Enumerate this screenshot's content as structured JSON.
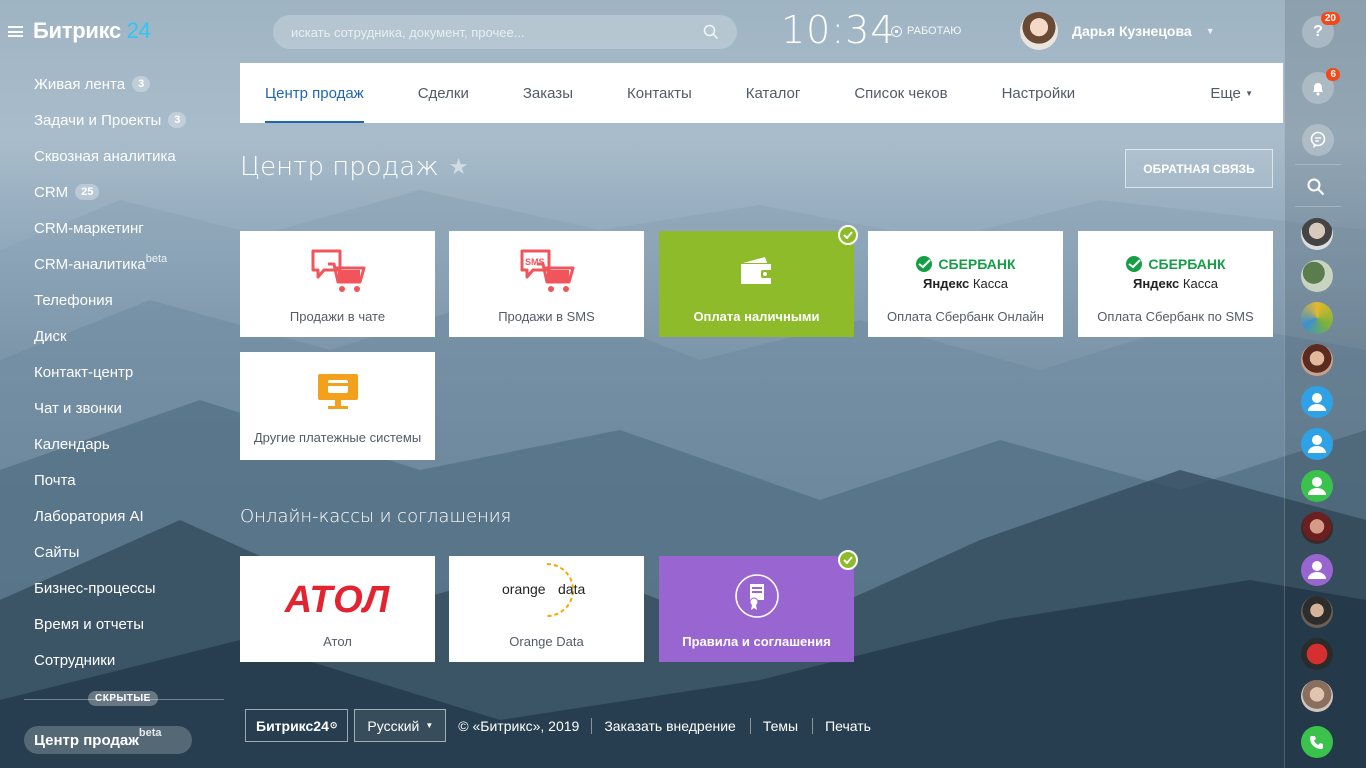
{
  "app": {
    "logo_main": "Битрикс",
    "logo_num": "24"
  },
  "search": {
    "placeholder": "искать сотрудника, документ, прочее..."
  },
  "clock": {
    "time": "10:34",
    "status": "РАБОТАЮ"
  },
  "user": {
    "name": "Дарья Кузнецова"
  },
  "sidebar": {
    "items": [
      {
        "label": "Живая лента",
        "badge": "3",
        "beta": ""
      },
      {
        "label": "Задачи и Проекты",
        "badge": "3",
        "beta": ""
      },
      {
        "label": "Сквозная аналитика",
        "badge": "",
        "beta": ""
      },
      {
        "label": "CRM",
        "badge": "25",
        "beta": ""
      },
      {
        "label": "CRM-маркетинг",
        "badge": "",
        "beta": ""
      },
      {
        "label": "CRM-аналитика",
        "badge": "",
        "beta": "beta"
      },
      {
        "label": "Телефония",
        "badge": "",
        "beta": ""
      },
      {
        "label": "Диск",
        "badge": "",
        "beta": ""
      },
      {
        "label": "Контакт-центр",
        "badge": "",
        "beta": ""
      },
      {
        "label": "Чат и звонки",
        "badge": "",
        "beta": ""
      },
      {
        "label": "Календарь",
        "badge": "",
        "beta": ""
      },
      {
        "label": "Почта",
        "badge": "",
        "beta": ""
      },
      {
        "label": "Лаборатория AI",
        "badge": "",
        "beta": ""
      },
      {
        "label": "Сайты",
        "badge": "",
        "beta": ""
      },
      {
        "label": "Бизнес-процессы",
        "badge": "",
        "beta": ""
      },
      {
        "label": "Время и отчеты",
        "badge": "",
        "beta": ""
      },
      {
        "label": "Сотрудники",
        "badge": "",
        "beta": ""
      }
    ],
    "hidden_label": "СКРЫТЫЕ",
    "active_item": {
      "label": "Центр продаж",
      "beta": "beta"
    }
  },
  "tabs": {
    "items": [
      "Центр продаж",
      "Сделки",
      "Заказы",
      "Контакты",
      "Каталог",
      "Список чеков",
      "Настройки"
    ],
    "more": "Еще"
  },
  "page": {
    "title": "Центр продаж",
    "feedback_button": "ОБРАТНАЯ СВЯЗЬ"
  },
  "tiles": {
    "chat": "Продажи в чате",
    "sms": "Продажи в SMS",
    "cash": "Оплата наличными",
    "sber_online": "Оплата Сбербанк Онлайн",
    "sber_sms": "Оплата Сбербанк по SMS",
    "other": "Другие платежные системы",
    "sber_logo": "СБЕРБАНК",
    "yandex_bold": "Яндекс",
    "yandex_rest": "Касса",
    "sms_icon_text": "SMS"
  },
  "section2": {
    "title": "Онлайн-кассы и соглашения",
    "atol": "Атол",
    "atol_logo": "АТОЛ",
    "orange": "Orange Data",
    "orange_logo_1": "orange",
    "orange_logo_2": "data",
    "rules": "Правила и соглашения"
  },
  "footer": {
    "brand": "Битрикс24",
    "language": "Русский",
    "copyright": "© «Битрикс», 2019",
    "links": [
      "Заказать внедрение",
      "Темы",
      "Печать"
    ]
  },
  "rightbar": {
    "help_count": "20",
    "notify_count": "6"
  },
  "colors": {
    "accent_blue": "#2067b0",
    "green": "#8dbb2a",
    "purple": "#9965d0",
    "badge_red": "#f54819",
    "sber_green": "#169e47",
    "atol_red": "#e3232f"
  }
}
